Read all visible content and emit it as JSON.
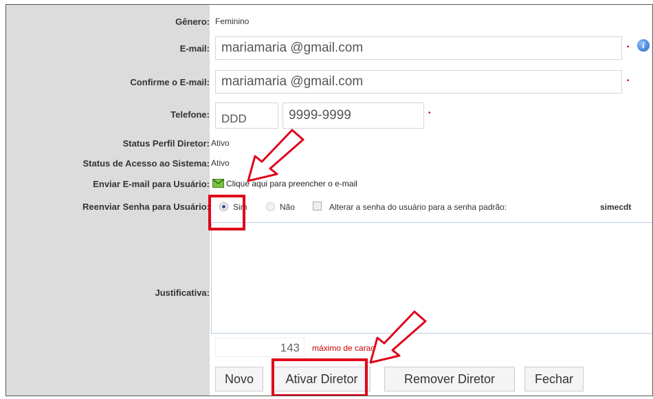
{
  "form": {
    "genero": {
      "label": "Gênero:",
      "value": "Feminino"
    },
    "email": {
      "label": "E-mail:",
      "value": "mariamaria @gmail.com"
    },
    "confirm_email": {
      "label": "Confirme o E-mail:",
      "value": "mariamaria @gmail.com"
    },
    "telefone": {
      "label": "Telefone:",
      "ddd": "DDD",
      "number": "9999-9999"
    },
    "status_perfil": {
      "label": "Status Perfil Diretor:",
      "value": "Ativo"
    },
    "status_acesso": {
      "label": "Status de Acesso ao Sistema:",
      "value": "Ativo"
    },
    "enviar_email": {
      "label": "Enviar E-mail para Usuário:",
      "link": "Clique aqui para preencher o e-mail"
    },
    "reenviar_senha": {
      "label": "Reenviar Senha para Usuário:",
      "sim": "Sim",
      "nao": "Não",
      "alterar": "Alterar a senha do usuário para a senha padrão:",
      "alterar_value": "simecdt",
      "selected": "Sim"
    },
    "justificativa": {
      "label": "Justificativa:",
      "counter": "143",
      "counter_text": "máximo de caracteres"
    },
    "required_mark": "•"
  },
  "buttons": {
    "novo": "Novo",
    "ativar": "Ativar Diretor",
    "remover": "Remover Diretor",
    "fechar": "Fechar"
  },
  "colors": {
    "label_bg": "#dcdcdc",
    "highlight": "#e0001a",
    "required": "#cc0000"
  }
}
